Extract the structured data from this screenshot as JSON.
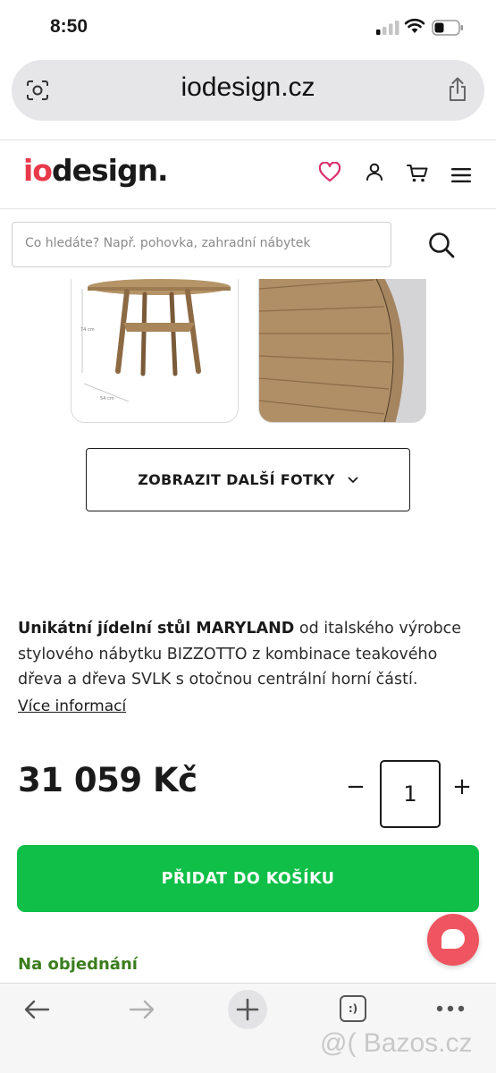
{
  "status_bar": {
    "time": "8:50"
  },
  "browser": {
    "url": "iodesign.cz"
  },
  "site": {
    "logo_io": "io",
    "logo_rest": "design.",
    "search": {
      "placeholder": "Co hledáte? Např. pohovka, zahradní nábytek"
    }
  },
  "gallery": {
    "dimension_height": "74 cm",
    "dimension_width": "54 cm",
    "more_button_label": "ZOBRAZIT DALŠÍ FOTKY"
  },
  "product": {
    "description_bold": "Unikátní jídelní stůl MARYLAND",
    "description_rest": " od italského výrobce stylového nábytku BIZZOTTO z kombinace teakového dřeva a dřeva SVLK s otočnou centrální horní částí.",
    "more_info_label": "Více informací",
    "price": "31 059 Kč",
    "quantity": "1",
    "qty_minus": "−",
    "qty_plus": "+",
    "add_to_cart_label": "PŘIDAT DO KOŠÍKU",
    "availability": "Na objednání"
  },
  "toolbar": {
    "tabs_label": ":)"
  },
  "watermark": "@( Bazos.cz",
  "colors": {
    "brand_red": "#e8394a",
    "cart_green": "#0fbf48",
    "availability_green": "#3b7d1e",
    "chat_red": "#ef5560"
  },
  "icons": [
    "lens-icon",
    "share-icon",
    "heart-icon",
    "user-icon",
    "cart-icon",
    "menu-icon",
    "search-icon",
    "chevron-down-icon",
    "chat-icon",
    "back-icon",
    "forward-icon",
    "new-tab-icon",
    "tabs-icon",
    "more-icon"
  ]
}
